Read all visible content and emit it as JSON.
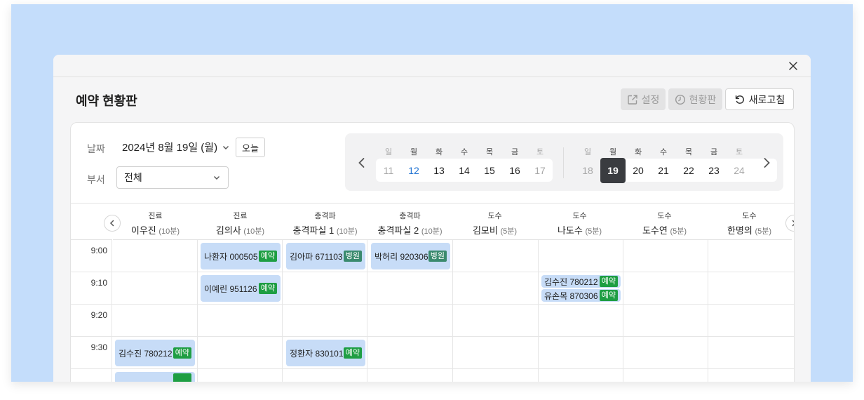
{
  "modal": {
    "title": "예약 현황판"
  },
  "header_buttons": {
    "settings": "설정",
    "status_board": "현황판",
    "refresh": "새로고침"
  },
  "filters": {
    "date_label": "날짜",
    "date_value": "2024년 8월 19일 (월)",
    "today_button": "오늘",
    "dept_label": "부서",
    "dept_value": "전체"
  },
  "weeks": [
    {
      "days": [
        {
          "dow": "일",
          "num": "11",
          "state": "weekend"
        },
        {
          "dow": "월",
          "num": "12",
          "state": "today"
        },
        {
          "dow": "화",
          "num": "13",
          "state": ""
        },
        {
          "dow": "수",
          "num": "14",
          "state": ""
        },
        {
          "dow": "목",
          "num": "15",
          "state": ""
        },
        {
          "dow": "금",
          "num": "16",
          "state": ""
        },
        {
          "dow": "토",
          "num": "17",
          "state": "weekend"
        }
      ]
    },
    {
      "days": [
        {
          "dow": "일",
          "num": "18",
          "state": "weekend"
        },
        {
          "dow": "월",
          "num": "19",
          "state": "selected"
        },
        {
          "dow": "화",
          "num": "20",
          "state": ""
        },
        {
          "dow": "수",
          "num": "21",
          "state": ""
        },
        {
          "dow": "목",
          "num": "22",
          "state": ""
        },
        {
          "dow": "금",
          "num": "23",
          "state": ""
        },
        {
          "dow": "토",
          "num": "24",
          "state": "weekend"
        }
      ]
    }
  ],
  "columns": [
    {
      "dept": "진료",
      "doctor": "이우진",
      "duration": "(10분)"
    },
    {
      "dept": "진료",
      "doctor": "김의사",
      "duration": "(10분)"
    },
    {
      "dept": "충격파",
      "doctor": "충격파실 1",
      "duration": "(10분)"
    },
    {
      "dept": "충격파",
      "doctor": "충격파실 2",
      "duration": "(10분)"
    },
    {
      "dept": "도수",
      "doctor": "김모비",
      "duration": "(5분)"
    },
    {
      "dept": "도수",
      "doctor": "나도수",
      "duration": "(5분)"
    },
    {
      "dept": "도수",
      "doctor": "도수연",
      "duration": "(5분)"
    },
    {
      "dept": "도수",
      "doctor": "한명의",
      "duration": "(5분)"
    }
  ],
  "times": [
    "9:00",
    "9:10",
    "9:20",
    "9:30"
  ],
  "appointments": [
    {
      "label": "나환자 000505",
      "badge": "예약",
      "badge_type": "reservation"
    },
    {
      "label": "김아파 671103",
      "badge": "병원",
      "badge_type": "hospital"
    },
    {
      "label": "박허리 920306",
      "badge": "병원",
      "badge_type": "hospital"
    },
    {
      "label": "이예린 951126",
      "badge": "예약",
      "badge_type": "reservation"
    },
    {
      "label": "김수진 780212",
      "badge": "예약",
      "badge_type": "reservation"
    },
    {
      "label": "유손목 870306",
      "badge": "예약",
      "badge_type": "reservation"
    },
    {
      "label": "김수진 780212",
      "badge": "예약",
      "badge_type": "reservation"
    },
    {
      "label": "정환자 830101",
      "badge": "예약",
      "badge_type": "reservation"
    },
    {
      "label": "",
      "badge": "",
      "badge_type": "reservation"
    }
  ],
  "colors": {
    "backdrop": "#c4ddfb",
    "chip": "#c7dcf7",
    "badge_reservation": "#1e9e43",
    "badge_hospital": "#3a8a6e",
    "selected_day": "#3a3c40",
    "today_day": "#2173d2"
  },
  "icons": {
    "close": "close-icon",
    "settings": "external-link-icon",
    "status_board": "clock-icon",
    "refresh": "refresh-icon",
    "date_dropdown": "chevron-down-icon",
    "prev": "chevron-left-icon",
    "next": "chevron-right-icon"
  }
}
